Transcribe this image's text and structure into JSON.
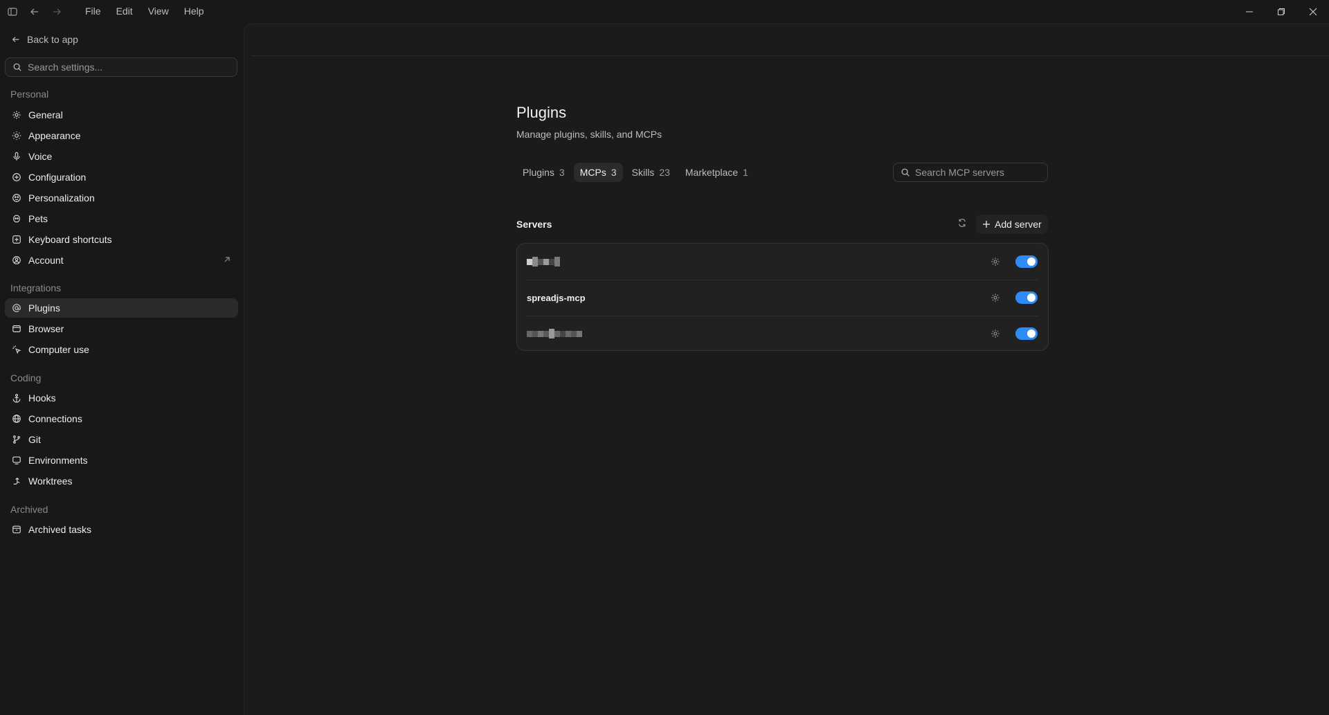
{
  "titlebar": {
    "menu": [
      "File",
      "Edit",
      "View",
      "Help"
    ]
  },
  "sidebar": {
    "back_label": "Back to app",
    "search_placeholder": "Search settings...",
    "sections": [
      {
        "title": "Personal",
        "items": [
          {
            "label": "General",
            "icon": "gear-icon"
          },
          {
            "label": "Appearance",
            "icon": "sun-icon"
          },
          {
            "label": "Voice",
            "icon": "mic-icon"
          },
          {
            "label": "Configuration",
            "icon": "sliders-icon"
          },
          {
            "label": "Personalization",
            "icon": "palette-icon"
          },
          {
            "label": "Pets",
            "icon": "pet-icon"
          },
          {
            "label": "Keyboard shortcuts",
            "icon": "keyboard-icon"
          },
          {
            "label": "Account",
            "icon": "account-icon"
          }
        ]
      },
      {
        "title": "Integrations",
        "items": [
          {
            "label": "Plugins",
            "icon": "at-icon"
          },
          {
            "label": "Browser",
            "icon": "browser-icon"
          },
          {
            "label": "Computer use",
            "icon": "cursor-icon"
          }
        ]
      },
      {
        "title": "Coding",
        "items": [
          {
            "label": "Hooks",
            "icon": "anchor-icon"
          },
          {
            "label": "Connections",
            "icon": "globe-icon"
          },
          {
            "label": "Git",
            "icon": "git-branch-icon"
          },
          {
            "label": "Environments",
            "icon": "monitor-icon"
          },
          {
            "label": "Worktrees",
            "icon": "worktree-icon"
          }
        ]
      },
      {
        "title": "Archived",
        "items": [
          {
            "label": "Archived tasks",
            "icon": "archive-icon"
          }
        ]
      }
    ]
  },
  "main": {
    "title": "Plugins",
    "subtitle": "Manage plugins, skills, and MCPs",
    "tabs": [
      {
        "label": "Plugins",
        "count": "3"
      },
      {
        "label": "MCPs",
        "count": "3"
      },
      {
        "label": "Skills",
        "count": "23"
      },
      {
        "label": "Marketplace",
        "count": "1"
      }
    ],
    "search_placeholder": "Search MCP servers",
    "servers_title": "Servers",
    "add_server_label": "Add server",
    "servers": [
      {
        "name": "",
        "redacted": true,
        "enabled": true
      },
      {
        "name": "spreadjs-mcp",
        "redacted": false,
        "enabled": true
      },
      {
        "name": "",
        "redacted": true,
        "enabled": true
      }
    ]
  },
  "colors": {
    "accent": "#2f8cf6",
    "background": "#181818",
    "panel": "#1b1b1b"
  }
}
